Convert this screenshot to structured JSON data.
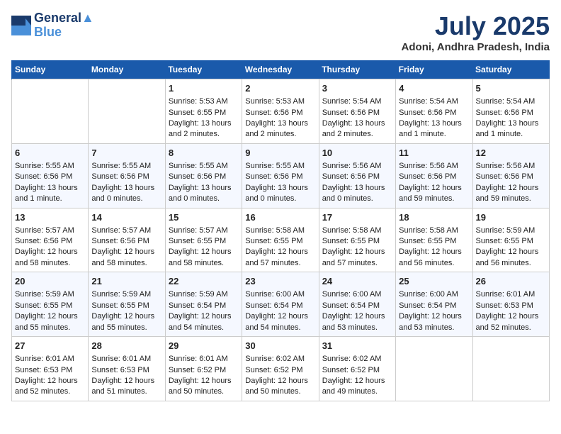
{
  "logo": {
    "line1": "General",
    "line2": "Blue"
  },
  "title": "July 2025",
  "location": "Adoni, Andhra Pradesh, India",
  "days_header": [
    "Sunday",
    "Monday",
    "Tuesday",
    "Wednesday",
    "Thursday",
    "Friday",
    "Saturday"
  ],
  "weeks": [
    [
      {
        "num": "",
        "info": ""
      },
      {
        "num": "",
        "info": ""
      },
      {
        "num": "1",
        "info": "Sunrise: 5:53 AM\nSunset: 6:55 PM\nDaylight: 13 hours and 2 minutes."
      },
      {
        "num": "2",
        "info": "Sunrise: 5:53 AM\nSunset: 6:56 PM\nDaylight: 13 hours and 2 minutes."
      },
      {
        "num": "3",
        "info": "Sunrise: 5:54 AM\nSunset: 6:56 PM\nDaylight: 13 hours and 2 minutes."
      },
      {
        "num": "4",
        "info": "Sunrise: 5:54 AM\nSunset: 6:56 PM\nDaylight: 13 hours and 1 minute."
      },
      {
        "num": "5",
        "info": "Sunrise: 5:54 AM\nSunset: 6:56 PM\nDaylight: 13 hours and 1 minute."
      }
    ],
    [
      {
        "num": "6",
        "info": "Sunrise: 5:55 AM\nSunset: 6:56 PM\nDaylight: 13 hours and 1 minute."
      },
      {
        "num": "7",
        "info": "Sunrise: 5:55 AM\nSunset: 6:56 PM\nDaylight: 13 hours and 0 minutes."
      },
      {
        "num": "8",
        "info": "Sunrise: 5:55 AM\nSunset: 6:56 PM\nDaylight: 13 hours and 0 minutes."
      },
      {
        "num": "9",
        "info": "Sunrise: 5:55 AM\nSunset: 6:56 PM\nDaylight: 13 hours and 0 minutes."
      },
      {
        "num": "10",
        "info": "Sunrise: 5:56 AM\nSunset: 6:56 PM\nDaylight: 13 hours and 0 minutes."
      },
      {
        "num": "11",
        "info": "Sunrise: 5:56 AM\nSunset: 6:56 PM\nDaylight: 12 hours and 59 minutes."
      },
      {
        "num": "12",
        "info": "Sunrise: 5:56 AM\nSunset: 6:56 PM\nDaylight: 12 hours and 59 minutes."
      }
    ],
    [
      {
        "num": "13",
        "info": "Sunrise: 5:57 AM\nSunset: 6:56 PM\nDaylight: 12 hours and 58 minutes."
      },
      {
        "num": "14",
        "info": "Sunrise: 5:57 AM\nSunset: 6:56 PM\nDaylight: 12 hours and 58 minutes."
      },
      {
        "num": "15",
        "info": "Sunrise: 5:57 AM\nSunset: 6:55 PM\nDaylight: 12 hours and 58 minutes."
      },
      {
        "num": "16",
        "info": "Sunrise: 5:58 AM\nSunset: 6:55 PM\nDaylight: 12 hours and 57 minutes."
      },
      {
        "num": "17",
        "info": "Sunrise: 5:58 AM\nSunset: 6:55 PM\nDaylight: 12 hours and 57 minutes."
      },
      {
        "num": "18",
        "info": "Sunrise: 5:58 AM\nSunset: 6:55 PM\nDaylight: 12 hours and 56 minutes."
      },
      {
        "num": "19",
        "info": "Sunrise: 5:59 AM\nSunset: 6:55 PM\nDaylight: 12 hours and 56 minutes."
      }
    ],
    [
      {
        "num": "20",
        "info": "Sunrise: 5:59 AM\nSunset: 6:55 PM\nDaylight: 12 hours and 55 minutes."
      },
      {
        "num": "21",
        "info": "Sunrise: 5:59 AM\nSunset: 6:55 PM\nDaylight: 12 hours and 55 minutes."
      },
      {
        "num": "22",
        "info": "Sunrise: 5:59 AM\nSunset: 6:54 PM\nDaylight: 12 hours and 54 minutes."
      },
      {
        "num": "23",
        "info": "Sunrise: 6:00 AM\nSunset: 6:54 PM\nDaylight: 12 hours and 54 minutes."
      },
      {
        "num": "24",
        "info": "Sunrise: 6:00 AM\nSunset: 6:54 PM\nDaylight: 12 hours and 53 minutes."
      },
      {
        "num": "25",
        "info": "Sunrise: 6:00 AM\nSunset: 6:54 PM\nDaylight: 12 hours and 53 minutes."
      },
      {
        "num": "26",
        "info": "Sunrise: 6:01 AM\nSunset: 6:53 PM\nDaylight: 12 hours and 52 minutes."
      }
    ],
    [
      {
        "num": "27",
        "info": "Sunrise: 6:01 AM\nSunset: 6:53 PM\nDaylight: 12 hours and 52 minutes."
      },
      {
        "num": "28",
        "info": "Sunrise: 6:01 AM\nSunset: 6:53 PM\nDaylight: 12 hours and 51 minutes."
      },
      {
        "num": "29",
        "info": "Sunrise: 6:01 AM\nSunset: 6:52 PM\nDaylight: 12 hours and 50 minutes."
      },
      {
        "num": "30",
        "info": "Sunrise: 6:02 AM\nSunset: 6:52 PM\nDaylight: 12 hours and 50 minutes."
      },
      {
        "num": "31",
        "info": "Sunrise: 6:02 AM\nSunset: 6:52 PM\nDaylight: 12 hours and 49 minutes."
      },
      {
        "num": "",
        "info": ""
      },
      {
        "num": "",
        "info": ""
      }
    ]
  ]
}
